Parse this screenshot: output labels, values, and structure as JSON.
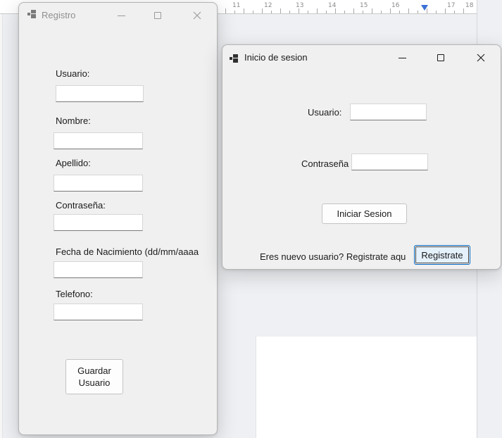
{
  "registro": {
    "title": "Registro",
    "fields": [
      {
        "label": "Usuario:",
        "value": ""
      },
      {
        "label": "Nombre:",
        "value": ""
      },
      {
        "label": "Apellido:",
        "value": ""
      },
      {
        "label": "Contraseña:",
        "value": ""
      },
      {
        "label": "Fecha de Nacimiento (dd/mm/aaaa",
        "value": ""
      },
      {
        "label": "Telefono:",
        "value": ""
      }
    ],
    "save_button": "Guardar Usuario"
  },
  "login": {
    "title": "Inicio de sesion",
    "usuario_label": "Usuario:",
    "usuario_value": "",
    "password_label": "Contraseña",
    "password_value": "",
    "login_button": "Iniciar Sesion",
    "register_prompt": "Eres nuevo usuario? Registrate aqu",
    "register_button": "Registrate"
  },
  "ruler": {
    "numbers": [
      "11",
      "12",
      "13",
      "14",
      "15",
      "16",
      "17",
      "18"
    ]
  },
  "icons": {
    "app": "app-window-icon",
    "minimize": "minimize-icon",
    "maximize": "maximize-icon",
    "close": "close-icon"
  },
  "colors": {
    "window_bg": "#f0f0f0",
    "focus_accent": "#0067c0",
    "ruler_marker": "#3b6fd6"
  }
}
